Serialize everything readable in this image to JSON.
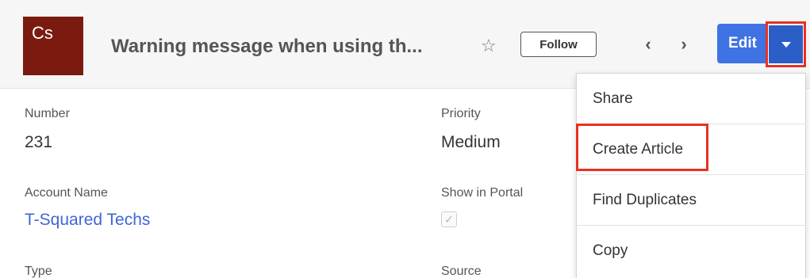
{
  "header": {
    "avatar_text": "Cs",
    "record_title": "Warning message when using th...",
    "follow_label": "Follow",
    "edit_label": "Edit",
    "prev_symbol": "‹",
    "next_symbol": "›",
    "star_symbol": "☆",
    "icons": [
      "star-icon",
      "chevron-left-icon",
      "chevron-right-icon",
      "caret-down-icon"
    ],
    "colors": {
      "avatar_bg": "#7b1b0f",
      "edit_bg": "#3f73e3",
      "highlight": "#e8311f"
    }
  },
  "fields": {
    "number": {
      "label": "Number",
      "value": "231"
    },
    "priority": {
      "label": "Priority",
      "value": "Medium"
    },
    "account_name": {
      "label": "Account Name",
      "value": "T-Squared Techs"
    },
    "show_in_portal": {
      "label": "Show in Portal",
      "checked": true,
      "check_symbol": "✓"
    },
    "type": {
      "label": "Type"
    },
    "source": {
      "label": "Source"
    }
  },
  "dropdown": {
    "items": [
      {
        "label": "Share"
      },
      {
        "label": "Create Article"
      },
      {
        "label": "Find Duplicates"
      },
      {
        "label": "Copy"
      }
    ]
  }
}
